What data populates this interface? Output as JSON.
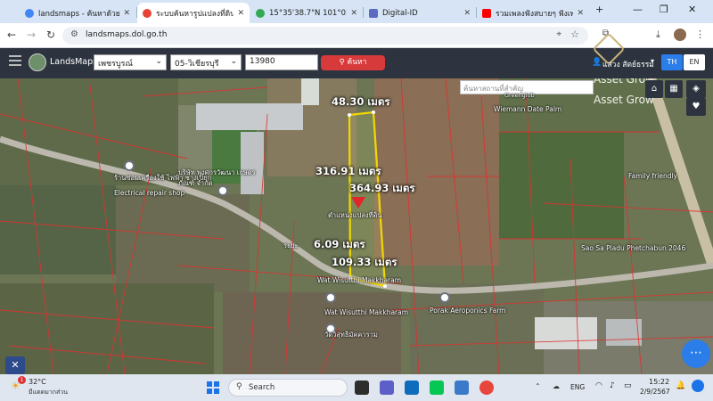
{
  "tabs": [
    {
      "title": "landsmaps - ค้นหาด้วย Go",
      "color": "#4285f4"
    },
    {
      "title": "ระบบค้นหารูปแปลงที่ดิน (Lan",
      "color": "#e94335"
    },
    {
      "title": "15°35'38.7\"N 101°03'38.",
      "color": "#34a853"
    },
    {
      "title": "Digital-ID",
      "color": "#5b6bbf"
    },
    {
      "title": "รวมเพลงฟังสบายๆ ฟังเพล",
      "color": "#ff0000"
    }
  ],
  "browser": {
    "url": "landsmaps.dol.go.th",
    "new_tab": "+",
    "min": "—",
    "restore": "❐",
    "close": "✕"
  },
  "header": {
    "app_name": "LandsMaps",
    "province": "เพชรบูรณ์",
    "district": "05-วิเชียรบุรี",
    "parcel_no": "13980",
    "search_label": "ค้นหา",
    "asset_label": "ASSET",
    "user_name": "แสวง สัตย์ธรรม์",
    "lang_th": "TH",
    "lang_en": "EN"
  },
  "map": {
    "place_search_placeholder": "ค้นหาสถานที่สำคัญ",
    "watermark_1": "Asset Grow",
    "watermark_2": "Asset Grow",
    "measure_top": "48.30 เมตร",
    "measure_left": "316.91 เมตร",
    "measure_right": "364.93 เมตร",
    "measure_bottom_a": "6.09 เมตร",
    "measure_bottom_b": "109.33 เมตร",
    "parcel_label": "ตำแหน่งแปลงที่ดิน",
    "labels": {
      "wiemann": "Wiemann Date Palm",
      "greenglobe": "Greenglob",
      "company": "บริษัท พงศกรวัฒนา เกษตรภัณฑ์ จำกัด",
      "shop": "ร้านซ่อมเครื่องใช้ ไฟฟ้า ช่างเปี๊ยก",
      "shop_en": "Electrical repair shop",
      "family": "Family friendly",
      "road": "Sao Sa Pladu Phetchabun 2046",
      "wat1": "Wat Wisutthi Makkharam",
      "wat2": "Wat Wisutthi Makkharam",
      "wat2_th": "วัดวิสุทธิมัคคาราม",
      "porak": "Porak Aeroponics Farm",
      "road_th": "ระยะ"
    }
  },
  "taskbar": {
    "temperature": "32°C",
    "weather": "มีแดดมากส่วน",
    "search_placeholder": "Search",
    "lang": "ENG",
    "time": "15:22",
    "date": "2/9/2567",
    "notify_count": "1"
  }
}
